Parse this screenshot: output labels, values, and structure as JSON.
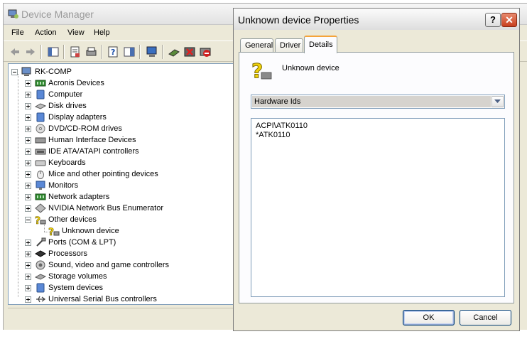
{
  "device_manager": {
    "title": "Device Manager",
    "menu": [
      "File",
      "Action",
      "View",
      "Help"
    ],
    "toolbar_icons": [
      "back-arrow-icon",
      "forward-arrow-icon",
      "console-tree-icon",
      "properties-icon",
      "print-icon",
      "help-icon",
      "show-hide-icon",
      "scan-hardware-icon",
      "update-driver-icon",
      "uninstall-icon",
      "disable-icon"
    ],
    "tree": {
      "root": "RK-COMP",
      "items": [
        {
          "label": "Acronis Devices",
          "icon": "acronis-device-icon",
          "expanded": false
        },
        {
          "label": "Computer",
          "icon": "computer-icon",
          "expanded": false
        },
        {
          "label": "Disk drives",
          "icon": "disk-drive-icon",
          "expanded": false
        },
        {
          "label": "Display adapters",
          "icon": "display-adapter-icon",
          "expanded": false
        },
        {
          "label": "DVD/CD-ROM drives",
          "icon": "dvd-drive-icon",
          "expanded": false
        },
        {
          "label": "Human Interface Devices",
          "icon": "hid-icon",
          "expanded": false
        },
        {
          "label": "IDE ATA/ATAPI controllers",
          "icon": "ide-controller-icon",
          "expanded": false
        },
        {
          "label": "Keyboards",
          "icon": "keyboard-icon",
          "expanded": false
        },
        {
          "label": "Mice and other pointing devices",
          "icon": "mouse-icon",
          "expanded": false
        },
        {
          "label": "Monitors",
          "icon": "monitor-icon",
          "expanded": false
        },
        {
          "label": "Network adapters",
          "icon": "network-adapter-icon",
          "expanded": false
        },
        {
          "label": "NVIDIA Network Bus Enumerator",
          "icon": "bus-enumerator-icon",
          "expanded": false
        },
        {
          "label": "Other devices",
          "icon": "unknown-device-icon",
          "expanded": true,
          "children": [
            {
              "label": "Unknown device",
              "icon": "unknown-device-icon"
            }
          ]
        },
        {
          "label": "Ports (COM & LPT)",
          "icon": "port-icon",
          "expanded": false
        },
        {
          "label": "Processors",
          "icon": "processor-icon",
          "expanded": false
        },
        {
          "label": "Sound, video and game controllers",
          "icon": "sound-icon",
          "expanded": false
        },
        {
          "label": "Storage volumes",
          "icon": "storage-volume-icon",
          "expanded": false
        },
        {
          "label": "System devices",
          "icon": "system-device-icon",
          "expanded": false
        },
        {
          "label": "Universal Serial Bus controllers",
          "icon": "usb-icon",
          "expanded": false
        }
      ]
    }
  },
  "properties_dialog": {
    "title": "Unknown device Properties",
    "help_label": "?",
    "close_label": "✕",
    "tabs": [
      {
        "label": "General",
        "active": false
      },
      {
        "label": "Driver",
        "active": false
      },
      {
        "label": "Details",
        "active": true
      }
    ],
    "device_name": "Unknown device",
    "property_select": "Hardware Ids",
    "values": [
      "ACPI\\ATK0110",
      "*ATK0110"
    ],
    "ok_label": "OK",
    "cancel_label": "Cancel"
  },
  "colors": {
    "window_bg": "#ece9d8",
    "tab_highlight": "#f5a43a",
    "close_red": "#c8401f",
    "field_border": "#7f9db9"
  }
}
